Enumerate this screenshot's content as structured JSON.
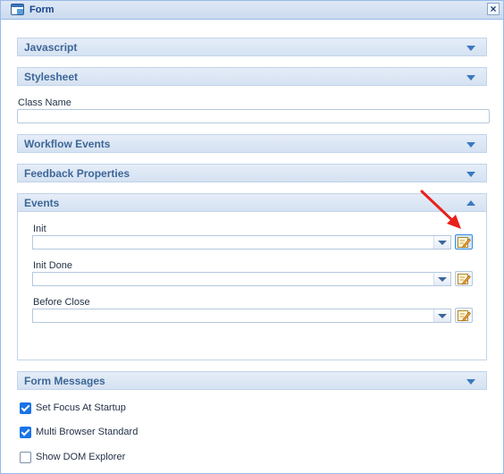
{
  "window": {
    "title": "Form",
    "close_label": "×"
  },
  "sections": {
    "javascript": "Javascript",
    "stylesheet": "Stylesheet",
    "workflow_events": "Workflow Events",
    "feedback_properties": "Feedback Properties",
    "events": "Events",
    "form_messages": "Form Messages"
  },
  "class_name": {
    "label": "Class Name",
    "value": ""
  },
  "events": {
    "fields": [
      {
        "label": "Init",
        "value": ""
      },
      {
        "label": "Init Done",
        "value": ""
      },
      {
        "label": "Before Close",
        "value": ""
      }
    ]
  },
  "options": [
    {
      "label": "Set Focus At Startup",
      "checked": true
    },
    {
      "label": "Multi Browser Standard",
      "checked": true
    },
    {
      "label": "Show DOM Explorer",
      "checked": false
    }
  ],
  "colors": {
    "accent": "#3b78c0",
    "annotation_arrow": "#e8201c",
    "checkbox_checked": "#1a73e8"
  }
}
